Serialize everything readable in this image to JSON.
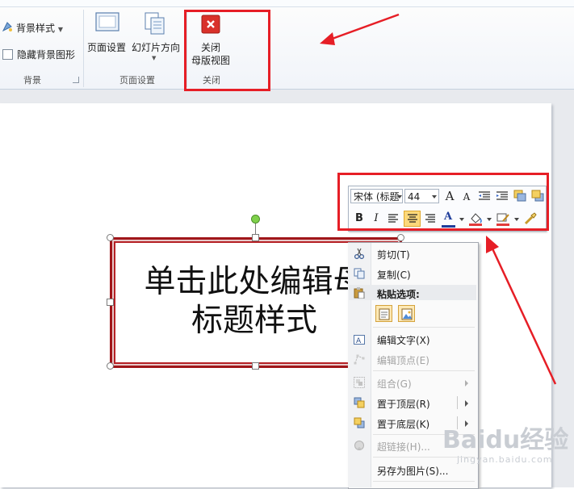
{
  "ribbon": {
    "background_group": {
      "style_button": "背景样式",
      "hide_checkbox_label": "隐藏背景图形",
      "hide_checked": false,
      "group_label": "背景"
    },
    "page_setup_group": {
      "page_setup_button": "页面设置",
      "orientation_button": "幻灯片方向",
      "group_label": "页面设置"
    },
    "close_group": {
      "close_button_line1": "关闭",
      "close_button_line2": "母版视图",
      "group_label": "关闭"
    }
  },
  "slide": {
    "title_line1": "单击此处编辑母",
    "title_line2": "标题样式"
  },
  "mini_toolbar": {
    "font_name": "宋体 (标题",
    "font_size": "44",
    "grow_font": "A",
    "shrink_font": "A",
    "bold": "B",
    "italic": "I",
    "font_color_glyph": "A",
    "font_color": "#1f3d9a",
    "highlight_color": "#e23b3b"
  },
  "context_menu": {
    "items": [
      {
        "label": "剪切(T)",
        "icon": "scissors-icon",
        "enabled": true
      },
      {
        "label": "复制(C)",
        "icon": "copy-icon",
        "enabled": true
      },
      {
        "label": "粘贴选项:",
        "icon": "paste-icon",
        "enabled": true
      },
      {
        "label": "编辑文字(X)",
        "icon": "edit-text-icon",
        "enabled": true
      },
      {
        "label": "编辑顶点(E)",
        "icon": "edit-points-icon",
        "enabled": false
      },
      {
        "label": "组合(G)",
        "icon": "group-icon",
        "enabled": false
      },
      {
        "label": "置于顶层(R)",
        "icon": "bring-to-front-icon",
        "enabled": true
      },
      {
        "label": "置于底层(K)",
        "icon": "send-to-back-icon",
        "enabled": true
      },
      {
        "label": "超链接(H)...",
        "icon": "hyperlink-icon",
        "enabled": false
      },
      {
        "label": "另存为图片(S)...",
        "icon": "save-as-picture-icon",
        "enabled": true
      }
    ]
  },
  "watermark": {
    "brand": "Baidu经验",
    "url": "jingyan.baidu.com"
  },
  "colors": {
    "annotation_red": "#e61e26",
    "title_border": "#a0161a",
    "close_icon": "#d9312a"
  }
}
